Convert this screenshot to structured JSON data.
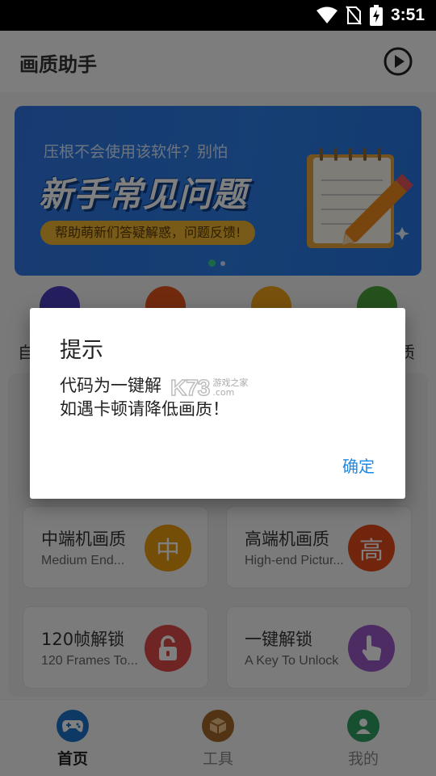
{
  "status_bar": {
    "time": "3:51",
    "icons": [
      "wifi-icon",
      "no-sim-icon",
      "battery-charging-icon"
    ]
  },
  "app_bar": {
    "title": "画质助手",
    "action_icon": "play-circle-icon"
  },
  "banner": {
    "subtitle": "压根不会使用该软件？别怕",
    "headline": "新手常见问题",
    "pill": "帮助萌新们答疑解惑，问题反馈!",
    "page_indicator": {
      "count": 2,
      "active": 1
    }
  },
  "quick_row": {
    "left_label_fragment": "自",
    "right_label_fragment": "质"
  },
  "cards": [
    {
      "title": "中端机画质",
      "subtitle": "Medium End...",
      "badge": "中",
      "badge_color": "#e89b0c"
    },
    {
      "title": "高端机画质",
      "subtitle": "High-end Pictur...",
      "badge": "高",
      "badge_color": "#e24a1a"
    },
    {
      "title": "120帧解锁",
      "subtitle": "120 Frames To...",
      "badge_icon": "unlock-icon",
      "badge_color": "#e14a4a"
    },
    {
      "title": "一键解锁",
      "subtitle": "A Key To Unlock",
      "badge_icon": "tap-hand-icon",
      "badge_color": "#9b57c6"
    }
  ],
  "bottom_nav": [
    {
      "label": "首页",
      "icon": "gamepad-icon",
      "active": true
    },
    {
      "label": "工具",
      "icon": "box-icon",
      "active": false
    },
    {
      "label": "我的",
      "icon": "person-icon",
      "active": false
    }
  ],
  "dialog": {
    "title": "提示",
    "message_line1": "代码为一键解",
    "message_line2": "如遇卡顿请降低画质！",
    "ok_label": "确定"
  },
  "watermark": {
    "main": "K73",
    "side_top": "游戏之家",
    "side_bottom": ".com"
  },
  "colors": {
    "accent": "#1e88e5",
    "banner": "#2f76e3",
    "nav_active": "#1a73c8"
  }
}
